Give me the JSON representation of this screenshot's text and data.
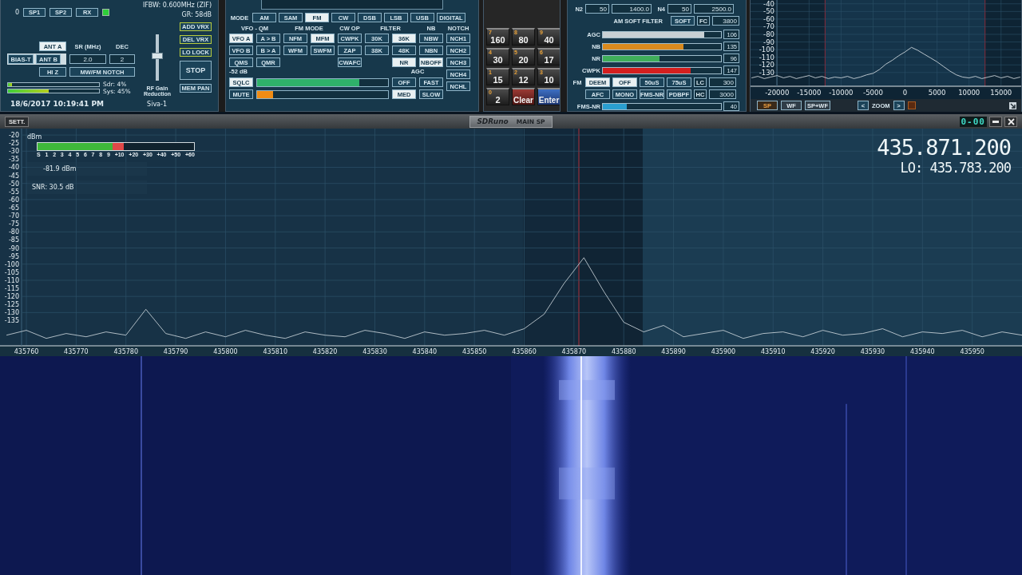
{
  "control_panel": {
    "counter": "0",
    "source_buttons": [
      "SP1",
      "SP2",
      "RX"
    ],
    "indicator_on": true,
    "ifbw": "IFBW: 0.600MHz (ZIF)",
    "gain_reduction": "GR: 58dB",
    "antenna_buttons": [
      {
        "label": "ANT A",
        "selected": true
      },
      {
        "label": "ANT B",
        "selected": false
      }
    ],
    "bias_t": {
      "label": "BIAS-T",
      "on": false
    },
    "hi_z": {
      "label": "HI Z",
      "on": false
    },
    "sample_rate": {
      "label": "SR (MHz)",
      "value": "2.0"
    },
    "decimation": {
      "label": "DEC",
      "value": "2"
    },
    "notch_button": "MW/FM NOTCH",
    "rf_gain": {
      "label": "RF Gain Reduction",
      "level": 0.55
    },
    "side_buttons": [
      {
        "label": "ADD VRX",
        "kind": "accent"
      },
      {
        "label": "DEL VRX",
        "kind": "accent"
      },
      {
        "label": "LO LOCK",
        "kind": "accent"
      },
      {
        "label": "STOP",
        "kind": "large"
      },
      {
        "label": "MEM PAN",
        "kind": "plain"
      }
    ],
    "load_meters": [
      {
        "label": "Sdr: 4%",
        "level": 0.04
      },
      {
        "label": "Sys: 45%",
        "level": 0.45
      }
    ],
    "datetime": "18/6/2017 10:19:41 PM",
    "device": "Siva-1"
  },
  "rx_panel": {
    "mode_label": "MODE",
    "modes": [
      {
        "label": "AM",
        "selected": false
      },
      {
        "label": "SAM",
        "selected": false
      },
      {
        "label": "FM",
        "selected": true
      },
      {
        "label": "CW",
        "selected": false
      },
      {
        "label": "DSB",
        "selected": false
      },
      {
        "label": "LSB",
        "selected": false
      },
      {
        "label": "USB",
        "selected": false
      },
      {
        "label": "DIGITAL",
        "selected": false
      }
    ],
    "groups": [
      {
        "title": "VFO - QM",
        "columns": [
          [
            {
              "label": "VFO A",
              "selected": true
            },
            {
              "label": "VFO B",
              "selected": false
            },
            {
              "label": "QMS",
              "selected": false
            }
          ],
          [
            {
              "label": "A > B",
              "selected": false
            },
            {
              "label": "B > A",
              "selected": false
            },
            {
              "label": "QMR",
              "selected": false
            }
          ]
        ]
      },
      {
        "title": "FM MODE",
        "columns": [
          [
            {
              "label": "NFM",
              "selected": false
            },
            {
              "label": "WFM",
              "selected": false
            }
          ],
          [
            {
              "label": "MFM",
              "selected": true
            },
            {
              "label": "SWFM",
              "selected": false
            }
          ]
        ]
      },
      {
        "title": "CW OP",
        "columns": [
          [
            {
              "label": "CWPK",
              "selected": false
            },
            {
              "label": "ZAP",
              "selected": false
            },
            {
              "label": "CWAFC",
              "selected": false
            }
          ]
        ]
      },
      {
        "title": "FILTER",
        "columns": [
          [
            {
              "label": "30K",
              "selected": false
            },
            {
              "label": "38K",
              "selected": false
            }
          ],
          [
            {
              "label": "36K",
              "selected": true
            },
            {
              "label": "48K",
              "selected": false
            },
            {
              "label": "NR",
              "selected": true
            }
          ]
        ]
      },
      {
        "title": "NB",
        "columns": [
          [
            {
              "label": "NBW",
              "selected": false
            },
            {
              "label": "NBN",
              "selected": false
            },
            {
              "label": "NBOFF",
              "selected": true
            }
          ]
        ]
      }
    ],
    "notch": {
      "title": "NOTCH",
      "buttons": [
        {
          "label": "NCH1",
          "selected": false
        },
        {
          "label": "NCH2",
          "selected": false
        },
        {
          "label": "NCH3",
          "selected": false
        },
        {
          "label": "NCH4",
          "selected": false
        },
        {
          "label": "NCHL",
          "selected": false
        }
      ]
    },
    "squelch": {
      "reading": "-52 dB",
      "sqlc": {
        "label": "SQLC",
        "selected": true
      },
      "level": 0.78
    },
    "volume": {
      "mute": {
        "label": "MUTE",
        "selected": false
      },
      "level": 0.12
    },
    "agc": {
      "title": "AGC",
      "buttons": [
        {
          "label": "OFF",
          "selected": false
        },
        {
          "label": "FAST",
          "selected": false
        },
        {
          "label": "MED",
          "selected": true
        },
        {
          "label": "SLOW",
          "selected": false
        }
      ]
    }
  },
  "keypad": [
    {
      "digit": "7",
      "label": "160",
      "kind": "band"
    },
    {
      "digit": "8",
      "label": "80",
      "kind": "band"
    },
    {
      "digit": "9",
      "label": "40",
      "kind": "band"
    },
    {
      "digit": "4",
      "label": "30",
      "kind": "band"
    },
    {
      "digit": "5",
      "label": "20",
      "kind": "band"
    },
    {
      "digit": "6",
      "label": "17",
      "kind": "band"
    },
    {
      "digit": "1",
      "label": "15",
      "kind": "band"
    },
    {
      "digit": "2",
      "label": "12",
      "kind": "band"
    },
    {
      "digit": "3",
      "label": "10",
      "kind": "band"
    },
    {
      "digit": "0",
      "label": "2",
      "kind": "band"
    },
    {
      "label": "Clear",
      "kind": "clear"
    },
    {
      "label": "Enter",
      "kind": "enter"
    }
  ],
  "filter_panel": {
    "notch_filters": [
      {
        "label": "N2",
        "fields": [
          "50",
          "1400.0"
        ]
      },
      {
        "label": "N4",
        "fields": [
          "50",
          "2500.0"
        ]
      }
    ],
    "am_soft_filter": {
      "label": "AM SOFT FILTER",
      "button": "SOFT",
      "cutoff_label": "FC",
      "cutoff_value": "3800"
    },
    "sliders": [
      {
        "label": "AGC",
        "value": "106",
        "level": 0.86,
        "color": "#c8d0d4"
      },
      {
        "label": "NB",
        "value": "135",
        "level": 0.68,
        "color": "#d98a1e"
      },
      {
        "label": "NR",
        "value": "96",
        "level": 0.48,
        "color": "#3fae5a"
      },
      {
        "label": "CWPK",
        "value": "147",
        "level": 0.74,
        "color": "#d41f1f"
      }
    ],
    "fm_rows": [
      {
        "label": "FM",
        "buttons": [
          {
            "label": "DEEM",
            "selected": true
          },
          {
            "label": "OFF",
            "selected": true
          },
          {
            "label": "50uS",
            "selected": false
          },
          {
            "label": "75uS",
            "selected": false
          }
        ],
        "cutoff": {
          "label": "LC",
          "value": "300"
        }
      },
      {
        "buttons": [
          {
            "label": "AFC",
            "selected": false
          },
          {
            "label": "MONO",
            "selected": false
          },
          {
            "label": "FMS-NR",
            "selected": false
          },
          {
            "label": "PDBPF",
            "selected": false
          }
        ],
        "cutoff": {
          "label": "HC",
          "value": "3000"
        }
      }
    ],
    "fms_nr": {
      "label": "FMS-NR",
      "value": "40",
      "level": 0.2,
      "color": "#2a9fd0"
    }
  },
  "mini_spectrum": {
    "chart_data": {
      "type": "line",
      "xlim": [
        -24150,
        18150
      ],
      "ylim": [
        -148,
        -35
      ],
      "grid": true,
      "xticks": [
        {
          "value": -20000,
          "label": "-20000"
        },
        {
          "value": -15000,
          "label": "-15000"
        },
        {
          "value": -10000,
          "label": "-10000"
        },
        {
          "value": -5000,
          "label": "-5000"
        },
        {
          "value": 0,
          "label": "0"
        },
        {
          "value": 5000,
          "label": "5000"
        },
        {
          "value": 10000,
          "label": "10000"
        },
        {
          "value": 15000,
          "label": "15000"
        }
      ],
      "yticks": [
        {
          "value": -40,
          "label": "-40"
        },
        {
          "value": -50,
          "label": "-50"
        },
        {
          "value": -60,
          "label": "-60"
        },
        {
          "value": -70,
          "label": "-70"
        },
        {
          "value": -80,
          "label": "-80"
        },
        {
          "value": -90,
          "label": "-90"
        },
        {
          "value": -100,
          "label": "-100"
        },
        {
          "value": -110,
          "label": "-110"
        },
        {
          "value": -120,
          "label": "-120"
        },
        {
          "value": -130,
          "label": "-130"
        }
      ],
      "x": [
        -24000,
        -23000,
        -22000,
        -21000,
        -20000,
        -19000,
        -18000,
        -17000,
        -16000,
        -15000,
        -14000,
        -13000,
        -12000,
        -11000,
        -10000,
        -9000,
        -8000,
        -7000,
        -6000,
        -5000,
        -4000,
        -3000,
        -2000,
        -1000,
        0,
        1000,
        2000,
        3000,
        4000,
        5000,
        6000,
        7000,
        8000,
        9000,
        10000,
        11000,
        12000,
        13000,
        14000,
        15000,
        16000,
        17000,
        18000
      ],
      "series": [
        {
          "color": "#dfe6ea",
          "values": [
            -137,
            -135,
            -138,
            -136,
            -134,
            -137,
            -135,
            -138,
            -136,
            -134,
            -137,
            -135,
            -138,
            -136,
            -137,
            -135,
            -138,
            -136,
            -133,
            -131,
            -126,
            -119,
            -114,
            -108,
            -103,
            -97,
            -101,
            -106,
            -111,
            -116,
            -122,
            -128,
            -133,
            -136,
            -137,
            -135,
            -138,
            -136,
            -134,
            -137,
            -135,
            -138,
            -136
          ]
        }
      ]
    },
    "view_buttons": [
      {
        "label": "SP",
        "selected": true
      },
      {
        "label": "WF",
        "selected": false
      },
      {
        "label": "SP+WF",
        "selected": false
      }
    ],
    "zoom": {
      "previous": "<",
      "label": "ZOOM",
      "next": ">"
    }
  },
  "main_window": {
    "settings_button": "SETT.",
    "brand": "SDRuno",
    "title": "MAIN SP",
    "clock": "0-00",
    "frequency": "435.871.200",
    "lo": "LO: 435.783.200",
    "s_meter": {
      "unit": "dBm",
      "scale": [
        "S",
        "1",
        "2",
        "3",
        "4",
        "5",
        "6",
        "7",
        "8",
        "9",
        "+10",
        "+20",
        "+30",
        "+40",
        "+50",
        "+60"
      ],
      "level": 0.55
    },
    "signal": "-81.9 dBm",
    "snr": "SNR: 30.5 dB",
    "chart_data": {
      "type": "line",
      "xlim": [
        435754.7,
        435960
      ],
      "ylim": [
        -150.6,
        -16
      ],
      "grid": true,
      "xticks": [
        {
          "value": 435760,
          "label": "435760"
        },
        {
          "value": 435770,
          "label": "435770"
        },
        {
          "value": 435780,
          "label": "435780"
        },
        {
          "value": 435790,
          "label": "435790"
        },
        {
          "value": 435800,
          "label": "435800"
        },
        {
          "value": 435810,
          "label": "435810"
        },
        {
          "value": 435820,
          "label": "435820"
        },
        {
          "value": 435830,
          "label": "435830"
        },
        {
          "value": 435840,
          "label": "435840"
        },
        {
          "value": 435850,
          "label": "435850"
        },
        {
          "value": 435860,
          "label": "435860"
        },
        {
          "value": 435870,
          "label": "435870"
        },
        {
          "value": 435880,
          "label": "435880"
        },
        {
          "value": 435890,
          "label": "435890"
        },
        {
          "value": 435900,
          "label": "435900"
        },
        {
          "value": 435910,
          "label": "435910"
        },
        {
          "value": 435920,
          "label": "435920"
        },
        {
          "value": 435930,
          "label": "435930"
        },
        {
          "value": 435940,
          "label": "435940"
        },
        {
          "value": 435950,
          "label": "435950"
        }
      ],
      "yticks": [
        {
          "value": -20,
          "label": "-20"
        },
        {
          "value": -25,
          "label": "-25"
        },
        {
          "value": -30,
          "label": "-30"
        },
        {
          "value": -35,
          "label": "-35"
        },
        {
          "value": -40,
          "label": "-40"
        },
        {
          "value": -45,
          "label": "-45"
        },
        {
          "value": -50,
          "label": "-50"
        },
        {
          "value": -55,
          "label": "-55"
        },
        {
          "value": -60,
          "label": "-60"
        },
        {
          "value": -65,
          "label": "-65"
        },
        {
          "value": -70,
          "label": "-70"
        },
        {
          "value": -75,
          "label": "-75"
        },
        {
          "value": -80,
          "label": "-80"
        },
        {
          "value": -85,
          "label": "-85"
        },
        {
          "value": -90,
          "label": "-90"
        },
        {
          "value": -95,
          "label": "-95"
        },
        {
          "value": -100,
          "label": "-100"
        },
        {
          "value": -105,
          "label": "-105"
        },
        {
          "value": -110,
          "label": "-110"
        },
        {
          "value": -115,
          "label": "-115"
        },
        {
          "value": -120,
          "label": "-120"
        },
        {
          "value": -125,
          "label": "-125"
        },
        {
          "value": -130,
          "label": "-130"
        },
        {
          "value": -135,
          "label": "-135"
        }
      ],
      "x": [
        435756,
        435760,
        435764,
        435768,
        435772,
        435776,
        435780,
        435784,
        435788,
        435792,
        435796,
        435800,
        435804,
        435808,
        435812,
        435816,
        435820,
        435824,
        435828,
        435832,
        435836,
        435840,
        435844,
        435848,
        435852,
        435856,
        435860,
        435864,
        435868,
        435872,
        435876,
        435880,
        435884,
        435888,
        435892,
        435896,
        435900,
        435904,
        435908,
        435912,
        435916,
        435920,
        435924,
        435928,
        435932,
        435936,
        435940,
        435944,
        435948,
        435952,
        435956,
        435960
      ],
      "series": [
        {
          "color": "#d4dde2",
          "values": [
            -144,
            -141,
            -146,
            -143,
            -145,
            -142,
            -144,
            -128,
            -143,
            -146,
            -142,
            -145,
            -141,
            -144,
            -146,
            -142,
            -144,
            -145,
            -141,
            -143,
            -146,
            -142,
            -144,
            -143,
            -141,
            -144,
            -140,
            -131,
            -112,
            -96,
            -117,
            -136,
            -142,
            -138,
            -145,
            -143,
            -141,
            -146,
            -143,
            -142,
            -145,
            -141,
            -144,
            -143,
            -140,
            -145,
            -142,
            -143,
            -141,
            -145,
            -142,
            -144
          ]
        }
      ]
    }
  }
}
